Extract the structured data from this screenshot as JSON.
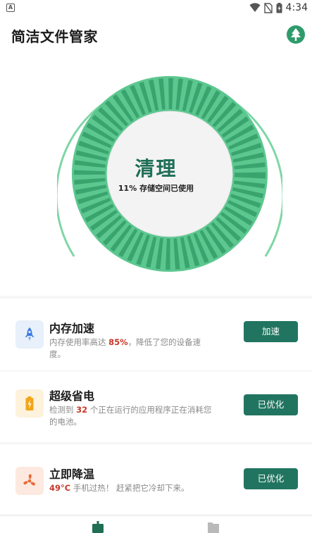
{
  "status_bar": {
    "time": "4:34",
    "icons": [
      "notification-a-icon",
      "wifi-icon",
      "no-sim-icon",
      "battery-charging-icon"
    ]
  },
  "app": {
    "title": "简洁文件管家",
    "header_icon": "tree-icon"
  },
  "hero": {
    "label": "清理",
    "usage_percent_text": "11%",
    "usage_text": "存储空间已使用",
    "colors": {
      "ring": "#5cc78f",
      "stripe": "#3aa46f",
      "label": "#1f6e55"
    }
  },
  "cards": [
    {
      "icon": "rocket-icon",
      "title": "内存加速",
      "desc_before": "内存使用率高达 ",
      "desc_highlight": "85%",
      "desc_after": "，降低了您的设备速度。",
      "button": "加速"
    },
    {
      "icon": "battery-icon",
      "title": "超级省电",
      "desc_before": "检测到 ",
      "desc_highlight": "32",
      "desc_after": " 个正在运行的应用程序正在消耗您的电池。",
      "button": "已优化"
    },
    {
      "icon": "fan-icon",
      "title": "立即降温",
      "desc_before": "",
      "desc_highlight": "49°C",
      "desc_after": " 手机过热！ 赶紧把它冷却下来。",
      "button": "已优化"
    }
  ],
  "bottom_nav": {
    "items": [
      "home-icon",
      "file-icon"
    ]
  },
  "colors": {
    "accent": "#217560",
    "highlight": "#c7382a"
  }
}
